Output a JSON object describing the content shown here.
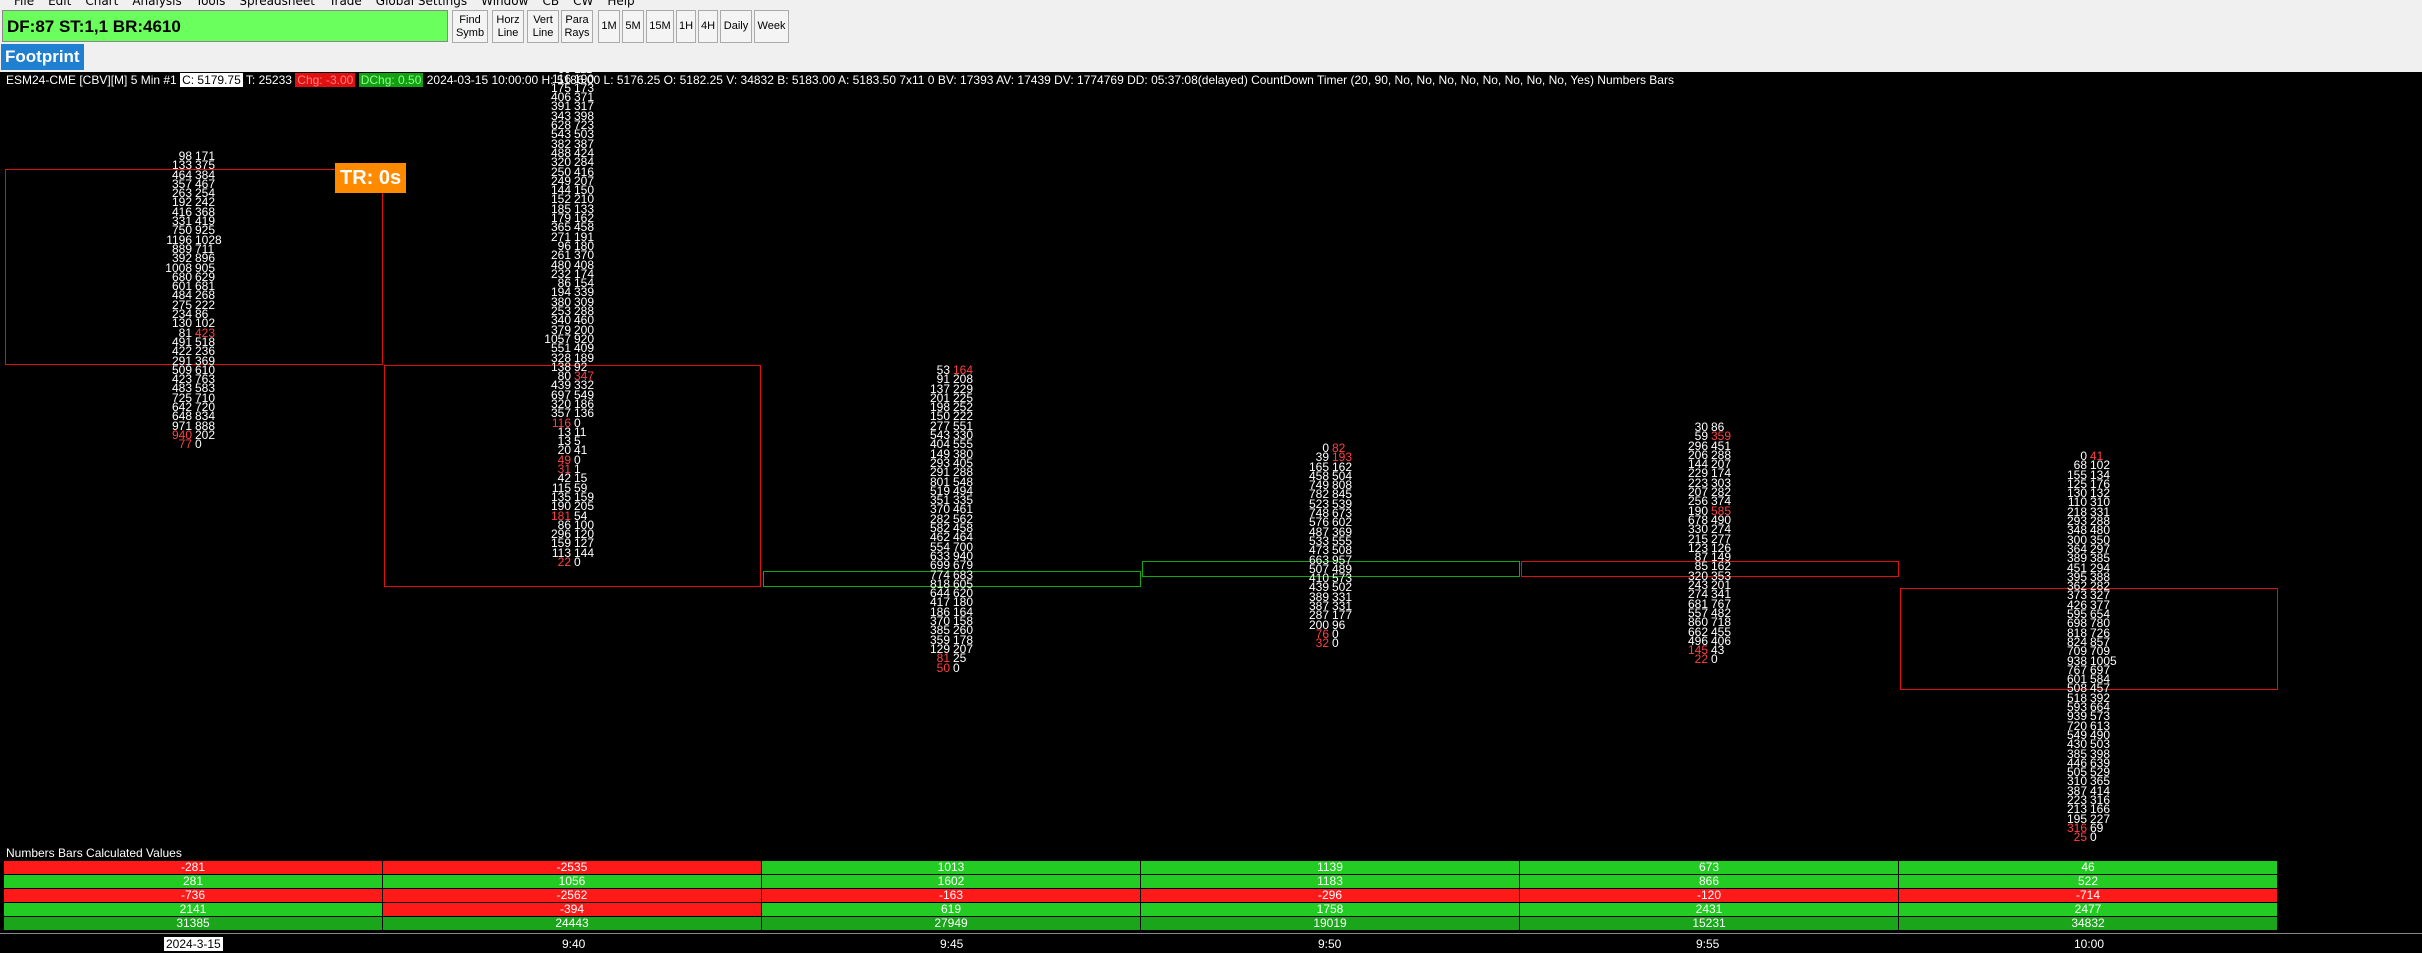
{
  "menu": [
    "File",
    "Edit",
    "Chart",
    "Analysis",
    "Tools",
    "Spreadsheet",
    "Trade",
    "Global Settings",
    "Window",
    "CB",
    "CW",
    "Help"
  ],
  "toolbar": {
    "status_text": "DF:87  ST:1,1  BR:4610",
    "buttons": [
      {
        "line1": "Find",
        "line2": "Symb"
      },
      {
        "line1": "Horz",
        "line2": "Line"
      },
      {
        "line1": "Vert",
        "line2": "Line"
      },
      {
        "line1": "Para",
        "line2": "Rays"
      }
    ],
    "timeframes": [
      "1M",
      "5M",
      "15M",
      "1H",
      "4H",
      "Daily",
      "Week"
    ]
  },
  "tab": {
    "label": "Footprint"
  },
  "header": {
    "symbol": "ESM24-CME [CBV][M]  5 Min  #1",
    "close": "C: 5179.75",
    "trades": "T: 25233",
    "chg": "Chg: -3.00",
    "dchg": "DChg: 0.50",
    "rest": "2024-03-15 10:00:00 H: 5186.00 L: 5176.25 O: 5182.25 V: 34832 B: 5183.00 A: 5183.50 7x11 0 BV: 17393 AV: 17439 DV: 1774769 DD: 05:37:08(delayed) CountDown Timer   (20, 90, No, No, No, No, No, No, No, No, Yes)  Numbers Bars"
  },
  "timer_label": "TR: 0s",
  "colors": {
    "bid_red": "#ff4040",
    "green": "#1fd01f",
    "red": "#ff1a1a",
    "bg": "#000000"
  },
  "footprint": [
    {
      "rows": [
        [
          "98",
          "171"
        ],
        [
          "133",
          "375"
        ],
        [
          "464",
          "384"
        ],
        [
          "357",
          "467"
        ],
        [
          "263",
          "254"
        ],
        [
          "192",
          "242"
        ],
        [
          "416",
          "368"
        ],
        [
          "331",
          "419"
        ],
        [
          "750",
          "925"
        ],
        [
          "1196",
          "1028"
        ],
        [
          "889",
          "711"
        ],
        [
          "392",
          "896"
        ],
        [
          "1008",
          "905"
        ],
        [
          "680",
          "629"
        ],
        [
          "601",
          "681"
        ],
        [
          "484",
          "268"
        ],
        [
          "275",
          "222"
        ],
        [
          "234",
          "86"
        ],
        [
          "130",
          "102"
        ],
        [
          "81",
          "423"
        ],
        [
          "491",
          "518"
        ],
        [
          "422",
          "236"
        ],
        [
          "291",
          "369"
        ],
        [
          "509",
          "610"
        ],
        [
          "423",
          "763"
        ],
        [
          "483",
          "583"
        ],
        [
          "725",
          "710"
        ],
        [
          "642",
          "720"
        ],
        [
          "648",
          "834"
        ],
        [
          "971",
          "888"
        ],
        [
          "940",
          "202"
        ],
        [
          "77",
          "0"
        ]
      ]
    },
    {
      "rows": [
        [
          "0",
          "31"
        ],
        [
          "69",
          "111"
        ],
        [
          "116",
          "190"
        ],
        [
          "175",
          "173"
        ],
        [
          "406",
          "371"
        ],
        [
          "391",
          "317"
        ],
        [
          "343",
          "398"
        ],
        [
          "628",
          "723"
        ],
        [
          "543",
          "503"
        ],
        [
          "382",
          "387"
        ],
        [
          "488",
          "424"
        ],
        [
          "320",
          "284"
        ],
        [
          "250",
          "416"
        ],
        [
          "249",
          "207"
        ],
        [
          "144",
          "150"
        ],
        [
          "152",
          "210"
        ],
        [
          "185",
          "133"
        ],
        [
          "179",
          "162"
        ],
        [
          "365",
          "458"
        ],
        [
          "271",
          "191"
        ],
        [
          "96",
          "180"
        ],
        [
          "261",
          "370"
        ],
        [
          "480",
          "408"
        ],
        [
          "232",
          "174"
        ],
        [
          "86",
          "154"
        ],
        [
          "194",
          "339"
        ],
        [
          "380",
          "309"
        ],
        [
          "253",
          "288"
        ],
        [
          "340",
          "460"
        ],
        [
          "379",
          "200"
        ],
        [
          "1057",
          "920"
        ],
        [
          "551",
          "409"
        ],
        [
          "328",
          "189"
        ],
        [
          "138",
          "92"
        ],
        [
          "80",
          "347"
        ],
        [
          "439",
          "332"
        ],
        [
          "697",
          "549"
        ],
        [
          "320",
          "186"
        ],
        [
          "357",
          "136"
        ],
        [
          "116",
          "0"
        ],
        [
          "13",
          "11"
        ],
        [
          "13",
          "5"
        ],
        [
          "20",
          "41"
        ],
        [
          "49",
          "0"
        ],
        [
          "31",
          "1"
        ],
        [
          "42",
          "15"
        ],
        [
          "115",
          "59"
        ],
        [
          "135",
          "159"
        ],
        [
          "190",
          "205"
        ],
        [
          "181",
          "54"
        ],
        [
          "86",
          "100"
        ],
        [
          "296",
          "120"
        ],
        [
          "159",
          "127"
        ],
        [
          "113",
          "144"
        ],
        [
          "22",
          "0"
        ]
      ]
    },
    {
      "rows": [
        [
          "53",
          "164"
        ],
        [
          "91",
          "208"
        ],
        [
          "137",
          "229"
        ],
        [
          "201",
          "225"
        ],
        [
          "198",
          "252"
        ],
        [
          "150",
          "222"
        ],
        [
          "277",
          "551"
        ],
        [
          "543",
          "330"
        ],
        [
          "404",
          "555"
        ],
        [
          "149",
          "380"
        ],
        [
          "293",
          "405"
        ],
        [
          "291",
          "288"
        ],
        [
          "801",
          "548"
        ],
        [
          "519",
          "494"
        ],
        [
          "351",
          "335"
        ],
        [
          "370",
          "461"
        ],
        [
          "282",
          "562"
        ],
        [
          "582",
          "458"
        ],
        [
          "462",
          "464"
        ],
        [
          "554",
          "700"
        ],
        [
          "633",
          "940"
        ],
        [
          "699",
          "679"
        ],
        [
          "774",
          "683"
        ],
        [
          "818",
          "605"
        ],
        [
          "644",
          "620"
        ],
        [
          "417",
          "180"
        ],
        [
          "186",
          "164"
        ],
        [
          "370",
          "158"
        ],
        [
          "385",
          "260"
        ],
        [
          "359",
          "178"
        ],
        [
          "129",
          "207"
        ],
        [
          "81",
          "25"
        ],
        [
          "50",
          "0"
        ]
      ]
    },
    {
      "rows": [
        [
          "0",
          "82"
        ],
        [
          "39",
          "193"
        ],
        [
          "165",
          "162"
        ],
        [
          "458",
          "504"
        ],
        [
          "749",
          "808"
        ],
        [
          "782",
          "845"
        ],
        [
          "523",
          "539"
        ],
        [
          "748",
          "673"
        ],
        [
          "576",
          "602"
        ],
        [
          "487",
          "369"
        ],
        [
          "533",
          "555"
        ],
        [
          "473",
          "508"
        ],
        [
          "663",
          "957"
        ],
        [
          "507",
          "489"
        ],
        [
          "410",
          "573"
        ],
        [
          "439",
          "502"
        ],
        [
          "389",
          "331"
        ],
        [
          "387",
          "331"
        ],
        [
          "287",
          "177"
        ],
        [
          "200",
          "96"
        ],
        [
          "76",
          "0"
        ],
        [
          "32",
          "0"
        ]
      ]
    },
    {
      "rows": [
        [
          "30",
          "86"
        ],
        [
          "59",
          "359"
        ],
        [
          "296",
          "451"
        ],
        [
          "206",
          "288"
        ],
        [
          "144",
          "207"
        ],
        [
          "229",
          "174"
        ],
        [
          "223",
          "303"
        ],
        [
          "207",
          "282"
        ],
        [
          "256",
          "374"
        ],
        [
          "190",
          "585"
        ],
        [
          "678",
          "490"
        ],
        [
          "330",
          "274"
        ],
        [
          "215",
          "277"
        ],
        [
          "123",
          "126"
        ],
        [
          "87",
          "149"
        ],
        [
          "85",
          "162"
        ],
        [
          "320",
          "353"
        ],
        [
          "243",
          "201"
        ],
        [
          "274",
          "341"
        ],
        [
          "681",
          "767"
        ],
        [
          "557",
          "482"
        ],
        [
          "860",
          "718"
        ],
        [
          "662",
          "455"
        ],
        [
          "496",
          "406"
        ],
        [
          "145",
          "43"
        ],
        [
          "22",
          "0"
        ]
      ]
    },
    {
      "rows": [
        [
          "0",
          "41"
        ],
        [
          "68",
          "102"
        ],
        [
          "155",
          "134"
        ],
        [
          "125",
          "176"
        ],
        [
          "130",
          "132"
        ],
        [
          "110",
          "310"
        ],
        [
          "218",
          "331"
        ],
        [
          "293",
          "288"
        ],
        [
          "348",
          "480"
        ],
        [
          "300",
          "350"
        ],
        [
          "364",
          "297"
        ],
        [
          "389",
          "385"
        ],
        [
          "451",
          "294"
        ],
        [
          "395",
          "388"
        ],
        [
          "362",
          "282"
        ],
        [
          "373",
          "327"
        ],
        [
          "426",
          "377"
        ],
        [
          "595",
          "654"
        ],
        [
          "698",
          "780"
        ],
        [
          "818",
          "726"
        ],
        [
          "824",
          "857"
        ],
        [
          "709",
          "709"
        ],
        [
          "938",
          "1005"
        ],
        [
          "767",
          "697"
        ],
        [
          "601",
          "584"
        ],
        [
          "508",
          "457"
        ],
        [
          "518",
          "392"
        ],
        [
          "593",
          "664"
        ],
        [
          "939",
          "573"
        ],
        [
          "720",
          "613"
        ],
        [
          "549",
          "490"
        ],
        [
          "430",
          "503"
        ],
        [
          "385",
          "398"
        ],
        [
          "446",
          "639"
        ],
        [
          "505",
          "529"
        ],
        [
          "310",
          "365"
        ],
        [
          "387",
          "414"
        ],
        [
          "223",
          "316"
        ],
        [
          "213",
          "166"
        ],
        [
          "195",
          "227"
        ],
        [
          "316",
          "69"
        ],
        [
          "25",
          "0"
        ]
      ]
    }
  ],
  "numbers_bars": {
    "title": "Numbers Bars Calculated Values",
    "rows": [
      {
        "values": [
          "-281",
          "-2535",
          "1013",
          "1139",
          "673",
          "46"
        ],
        "colors": [
          "#ff1a1a",
          "#ff1a1a",
          "#22cc22",
          "#22cc22",
          "#22cc22",
          "#22cc22"
        ]
      },
      {
        "values": [
          "281",
          "1056",
          "1602",
          "1183",
          "866",
          "522"
        ],
        "colors": [
          "#22cc22",
          "#22cc22",
          "#22cc22",
          "#22cc22",
          "#22cc22",
          "#22cc22"
        ]
      },
      {
        "values": [
          "-736",
          "-2562",
          "-163",
          "-296",
          "-120",
          "-714"
        ],
        "colors": [
          "#ff1a1a",
          "#ff1a1a",
          "#ff1a1a",
          "#ff1a1a",
          "#ff1a1a",
          "#ff1a1a"
        ]
      },
      {
        "values": [
          "2141",
          "-394",
          "619",
          "1758",
          "2431",
          "2477"
        ],
        "colors": [
          "#22cc22",
          "#ff1a1a",
          "#22cc22",
          "#22cc22",
          "#22cc22",
          "#22cc22"
        ]
      },
      {
        "values": [
          "31385",
          "24443",
          "27949",
          "19019",
          "15231",
          "34832"
        ],
        "colors": [
          "#1aa51a",
          "#1aa51a",
          "#1aa51a",
          "#1aa51a",
          "#1aa51a",
          "#1aa51a"
        ]
      }
    ]
  },
  "time_axis": {
    "date": "2024-3-15",
    "ticks": [
      "9:40",
      "9:45",
      "9:50",
      "9:55",
      "10:00"
    ]
  }
}
